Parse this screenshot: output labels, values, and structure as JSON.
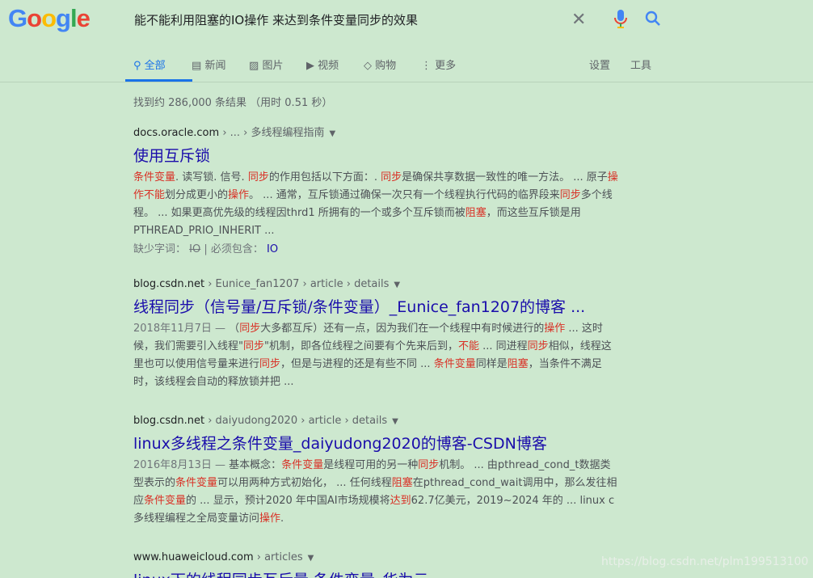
{
  "logo": {
    "letters": [
      "G",
      "o",
      "o",
      "g",
      "l",
      "e"
    ],
    "colors": [
      "#4285f4",
      "#ea4335",
      "#fbbc05",
      "#4285f4",
      "#34a853",
      "#ea4335"
    ]
  },
  "search": {
    "query": "能不能利用阻塞的IO操作 来达到条件变量同步的效果"
  },
  "tabs": [
    {
      "label": "全部",
      "icon": "search-icon"
    },
    {
      "label": "新闻",
      "icon": "news-icon"
    },
    {
      "label": "图片",
      "icon": "image-icon"
    },
    {
      "label": "视频",
      "icon": "video-icon"
    },
    {
      "label": "购物",
      "icon": "tag-icon"
    },
    {
      "label": "更多",
      "icon": "more-vert-icon"
    }
  ],
  "tools": {
    "settings": "设置",
    "tools": "工具"
  },
  "stats": "找到约 286,000 条结果 （用时 0.51 秒）",
  "results": [
    {
      "domain": "docs.oracle.com",
      "path": " › ... › 多线程编程指南",
      "title": "使用互斥锁",
      "snippet": [
        {
          "t": "条件变量",
          "em": true
        },
        {
          "t": ". 读写锁. 信号. ",
          "em": false
        },
        {
          "t": "同步",
          "em": true
        },
        {
          "t": "的作用包括以下方面：. ",
          "em": false
        },
        {
          "t": "同步",
          "em": true
        },
        {
          "t": "是确保共享数据一致性的唯一方法。 ... 原子",
          "em": false
        },
        {
          "t": "操作不能",
          "em": true
        },
        {
          "t": "划分成更小的",
          "em": false
        },
        {
          "t": "操作",
          "em": true
        },
        {
          "t": "。 ... 通常，互斥锁通过确保一次只有一个线程执行代码的临界段来",
          "em": false
        },
        {
          "t": "同步",
          "em": true
        },
        {
          "t": "多个线程。 ... 如果更高优先级的线程因thrd1 所拥有的一个或多个互斥锁而被",
          "em": false
        },
        {
          "t": "阻塞",
          "em": true
        },
        {
          "t": "，而这些互斥锁是用PTHREAD_PRIO_INHERIT ...",
          "em": false
        }
      ],
      "missing_label": "缺少字词：",
      "missing_word": "IO",
      "must_include_label": "| 必须包含：",
      "must_include_word": "IO"
    },
    {
      "domain": "blog.csdn.net",
      "path": " › Eunice_fan1207 › article › details",
      "title": "线程同步（信号量/互斥锁/条件变量）_Eunice_fan1207的博客 ...",
      "date": "2018年11月7日 — ",
      "snippet": [
        {
          "t": "（",
          "em": false
        },
        {
          "t": "同步",
          "em": true
        },
        {
          "t": "大多都互斥）还有一点，因为我们在一个线程中有时候进行的",
          "em": false
        },
        {
          "t": "操作",
          "em": true
        },
        {
          "t": " ... 这时候，我们需要引入线程\"",
          "em": false
        },
        {
          "t": "同步",
          "em": true
        },
        {
          "t": "\"机制，即各位线程之间要有个先来后到，",
          "em": false
        },
        {
          "t": "不能",
          "em": true
        },
        {
          "t": " ... 同进程",
          "em": false
        },
        {
          "t": "同步",
          "em": true
        },
        {
          "t": "相似，线程这里也可以使用信号量来进行",
          "em": false
        },
        {
          "t": "同步",
          "em": true
        },
        {
          "t": "，但是与进程的还是有些不同 ... ",
          "em": false
        },
        {
          "t": "条件变量",
          "em": true
        },
        {
          "t": "同样是",
          "em": false
        },
        {
          "t": "阻塞",
          "em": true
        },
        {
          "t": "，当条件不满足时，该线程会自动的释放锁并把 ...",
          "em": false
        }
      ]
    },
    {
      "domain": "blog.csdn.net",
      "path": " › daiyudong2020 › article › details",
      "title": "linux多线程之条件变量_daiyudong2020的博客-CSDN博客",
      "date": "2016年8月13日 — ",
      "snippet": [
        {
          "t": "基本概念：",
          "em": false
        },
        {
          "t": "条件变量",
          "em": true
        },
        {
          "t": "是线程可用的另一种",
          "em": false
        },
        {
          "t": "同步",
          "em": true
        },
        {
          "t": "机制。 ... 由pthread_cond_t数据类型表示的",
          "em": false
        },
        {
          "t": "条件变量",
          "em": true
        },
        {
          "t": "可以用两种方式初始化， ... 任何线程",
          "em": false
        },
        {
          "t": "阻塞",
          "em": true
        },
        {
          "t": "在pthread_cond_wait调用中，那么发往相应",
          "em": false
        },
        {
          "t": "条件变量",
          "em": true
        },
        {
          "t": "的 ... 显示，预计2020 年中国AI市场规模将",
          "em": false
        },
        {
          "t": "达到",
          "em": true
        },
        {
          "t": "62.7亿美元，2019~2024 年的 ... linux c多线程编程之全局变量访问",
          "em": false
        },
        {
          "t": "操作",
          "em": true
        },
        {
          "t": ".",
          "em": false
        }
      ]
    },
    {
      "domain": "www.huaweicloud.com",
      "path": " › articles",
      "title": "linux下的线程同步互斥量 条件变量_华为云"
    }
  ],
  "watermark": "https://blog.csdn.net/plm199513100"
}
